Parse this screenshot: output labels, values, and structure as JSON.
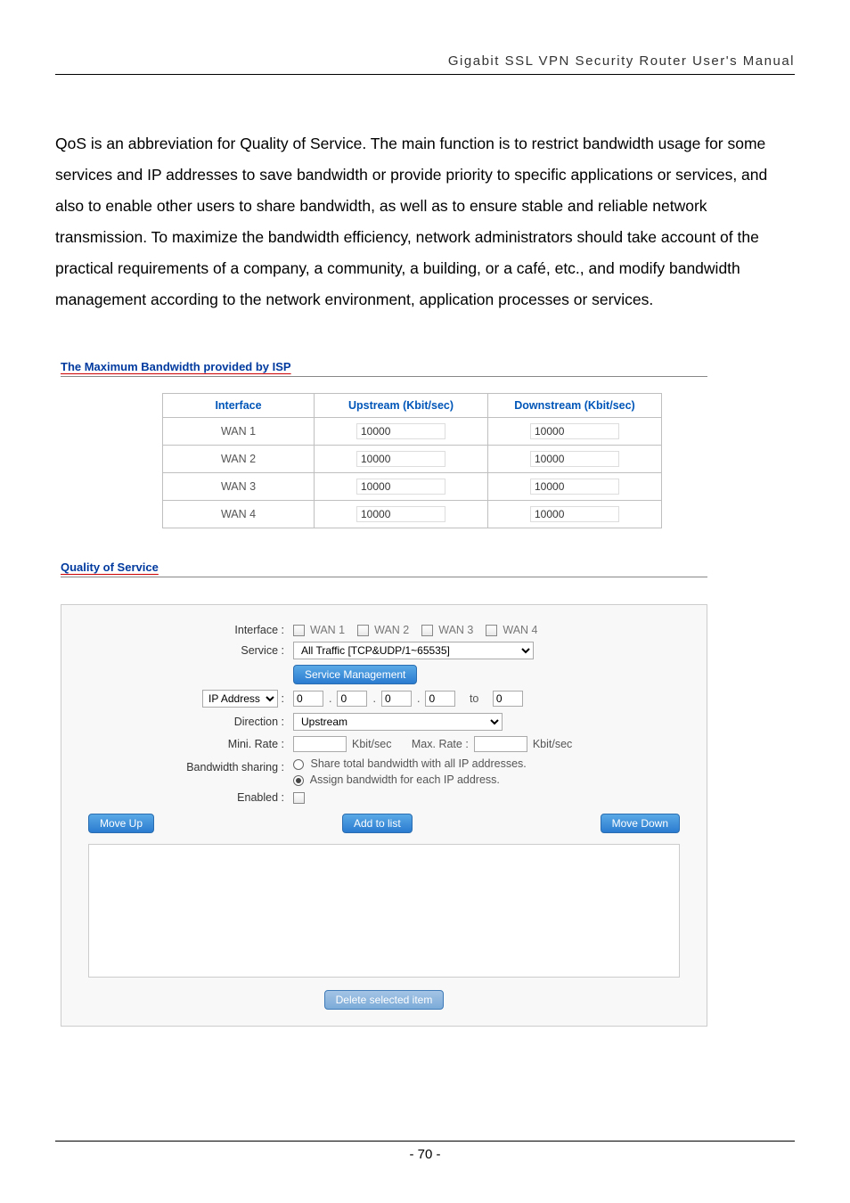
{
  "header": "Gigabit  SSL  VPN  Security  Router  User's  Manual",
  "intro": "QoS is an abbreviation for Quality of Service. The main function is to restrict bandwidth usage for some services and IP addresses to save bandwidth or provide priority to specific applications or services, and also to enable other users to share bandwidth, as well as to ensure stable and reliable network transmission. To maximize the bandwidth efficiency, network administrators should take account of the practical requirements of a company, a community, a building, or a café, etc., and modify bandwidth management according to the network environment, application processes or services.",
  "section_isp_title": "The Maximum Bandwidth provided by ISP",
  "bw_table": {
    "headers": {
      "iface": "Interface",
      "up": "Upstream (Kbit/sec)",
      "dn": "Downstream (Kbit/sec)"
    },
    "rows": [
      {
        "iface": "WAN 1",
        "up": "10000",
        "dn": "10000"
      },
      {
        "iface": "WAN 2",
        "up": "10000",
        "dn": "10000"
      },
      {
        "iface": "WAN 3",
        "up": "10000",
        "dn": "10000"
      },
      {
        "iface": "WAN 4",
        "up": "10000",
        "dn": "10000"
      }
    ]
  },
  "section_qos_title": "Quality of Service",
  "qos": {
    "labels": {
      "interface": "Interface :",
      "service": "Service :",
      "ip": "IP Address",
      "direction": "Direction :",
      "mini": "Mini. Rate :",
      "max": "Max. Rate :",
      "sharing": "Bandwidth sharing :",
      "enabled": "Enabled :"
    },
    "wans": [
      "WAN 1",
      "WAN 2",
      "WAN 3",
      "WAN 4"
    ],
    "service_value": "All Traffic [TCP&UDP/1~65535]",
    "service_mgmt_btn": "Service Management",
    "ip_selector": "IP Address",
    "ip_octets": [
      "0",
      "0",
      "0",
      "0"
    ],
    "ip_to_label": "to",
    "ip_to_value": "0",
    "direction_value": "Upstream",
    "rate_unit": "Kbit/sec",
    "sharing_opts": {
      "share": "Share total bandwidth with all IP addresses.",
      "assign": "Assign bandwidth for each IP address."
    },
    "buttons": {
      "move_up": "Move Up",
      "add": "Add to list",
      "move_down": "Move Down",
      "delete": "Delete selected item"
    }
  },
  "page_number": "- 70 -"
}
